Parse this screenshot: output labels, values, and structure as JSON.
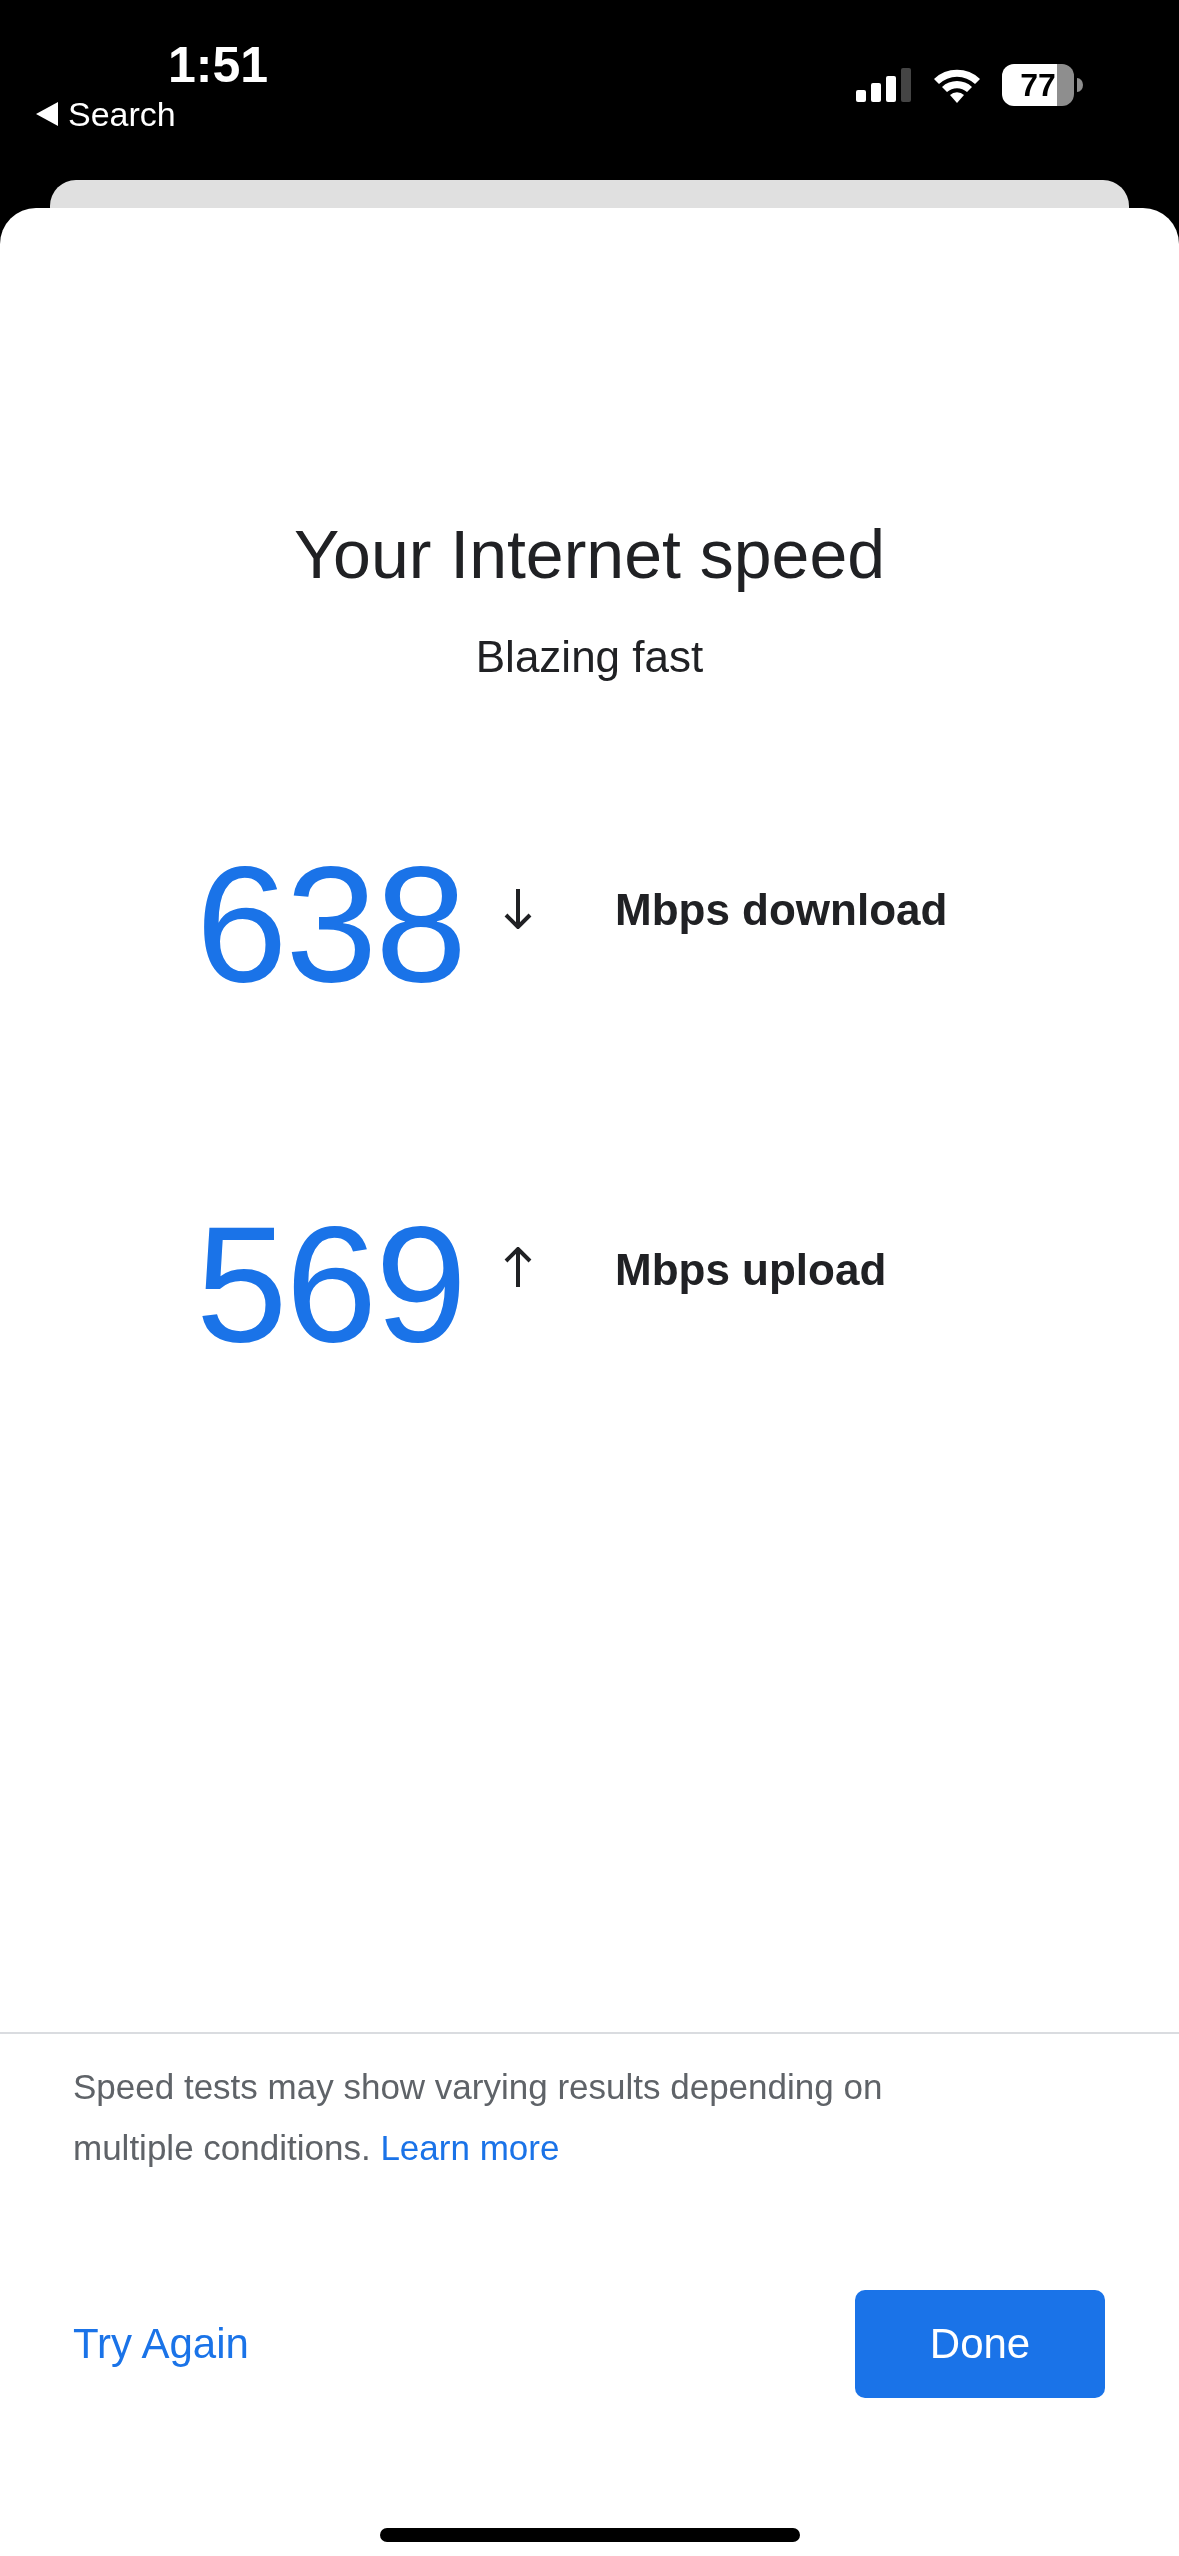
{
  "status_bar": {
    "time": "1:51",
    "back_label": "Search",
    "battery": "77"
  },
  "title": "Your Internet speed",
  "subtitle": "Blazing fast",
  "results": [
    {
      "kind": "download",
      "value": "638",
      "label": "Mbps download"
    },
    {
      "kind": "upload",
      "value": "569",
      "label": "Mbps upload"
    }
  ],
  "disclaimer": {
    "text": "Speed tests may show varying results depending on multiple conditions.",
    "link": "Learn more"
  },
  "buttons": {
    "secondary": "Try Again",
    "primary": "Done"
  }
}
